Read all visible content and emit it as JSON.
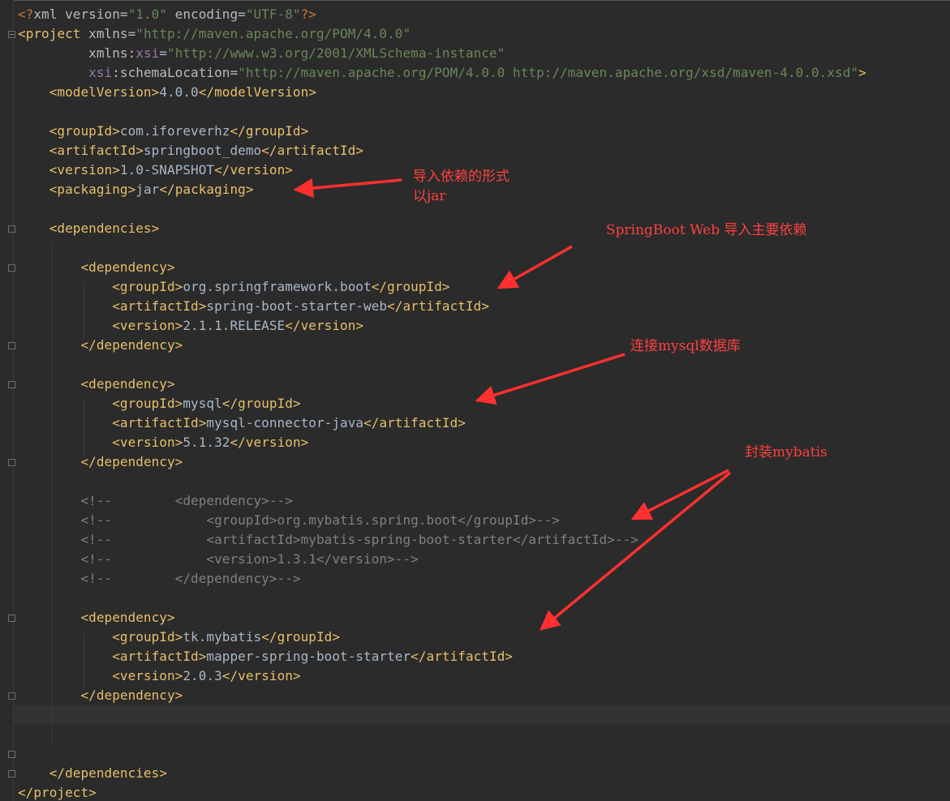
{
  "editor": {
    "colors": {
      "background": "#2b2b2b",
      "tag": "#e8bf6a",
      "string": "#6a8759",
      "namespace": "#9876aa",
      "text": "#a9b7c6",
      "comment": "#808080",
      "annotation": "#ff4040"
    },
    "lines": [
      {
        "indent": "",
        "tokens": [
          [
            "pi",
            "<?"
          ],
          [
            "attr",
            "xml version"
          ],
          [
            "text",
            "="
          ],
          [
            "str",
            "\"1.0\""
          ],
          [
            "attr",
            " encoding"
          ],
          [
            "text",
            "="
          ],
          [
            "str",
            "\"UTF-8\""
          ],
          [
            "pi",
            "?>"
          ]
        ]
      },
      {
        "indent": "",
        "tokens": [
          [
            "bracket",
            "<"
          ],
          [
            "tag",
            "project "
          ],
          [
            "attr",
            "xmlns"
          ],
          [
            "text",
            "="
          ],
          [
            "str",
            "\"http://maven.apache.org/POM/4.0.0\""
          ]
        ]
      },
      {
        "indent": "         ",
        "tokens": [
          [
            "attr",
            "xmlns:"
          ],
          [
            "ns",
            "xsi"
          ],
          [
            "text",
            "="
          ],
          [
            "str",
            "\"http://www.w3.org/2001/XMLSchema-instance\""
          ]
        ]
      },
      {
        "indent": "         ",
        "tokens": [
          [
            "ns",
            "xsi"
          ],
          [
            "attr",
            ":schemaLocation"
          ],
          [
            "text",
            "="
          ],
          [
            "str",
            "\"http://maven.apache.org/POM/4.0.0 http://maven.apache.org/xsd/maven-4.0.0.xsd\""
          ],
          [
            "bracket",
            ">"
          ]
        ]
      },
      {
        "indent": "    ",
        "tokens": [
          [
            "bracket",
            "<"
          ],
          [
            "tag",
            "modelVersion"
          ],
          [
            "bracket",
            ">"
          ],
          [
            "text",
            "4.0.0"
          ],
          [
            "bracket",
            "</"
          ],
          [
            "tag",
            "modelVersion"
          ],
          [
            "bracket",
            ">"
          ]
        ]
      },
      {
        "indent": "",
        "tokens": []
      },
      {
        "indent": "    ",
        "tokens": [
          [
            "bracket",
            "<"
          ],
          [
            "tag",
            "groupId"
          ],
          [
            "bracket",
            ">"
          ],
          [
            "text",
            "com.iforeverhz"
          ],
          [
            "bracket",
            "</"
          ],
          [
            "tag",
            "groupId"
          ],
          [
            "bracket",
            ">"
          ]
        ]
      },
      {
        "indent": "    ",
        "tokens": [
          [
            "bracket",
            "<"
          ],
          [
            "tag",
            "artifactId"
          ],
          [
            "bracket",
            ">"
          ],
          [
            "text",
            "springboot_demo"
          ],
          [
            "bracket",
            "</"
          ],
          [
            "tag",
            "artifactId"
          ],
          [
            "bracket",
            ">"
          ]
        ]
      },
      {
        "indent": "    ",
        "tokens": [
          [
            "bracket",
            "<"
          ],
          [
            "tag",
            "version"
          ],
          [
            "bracket",
            ">"
          ],
          [
            "text",
            "1.0-SNAPSHOT"
          ],
          [
            "bracket",
            "</"
          ],
          [
            "tag",
            "version"
          ],
          [
            "bracket",
            ">"
          ]
        ]
      },
      {
        "indent": "    ",
        "tokens": [
          [
            "bracket",
            "<"
          ],
          [
            "tag",
            "packaging"
          ],
          [
            "bracket",
            ">"
          ],
          [
            "text",
            "jar"
          ],
          [
            "bracket",
            "</"
          ],
          [
            "tag",
            "packaging"
          ],
          [
            "bracket",
            ">"
          ]
        ]
      },
      {
        "indent": "",
        "tokens": []
      },
      {
        "indent": "    ",
        "tokens": [
          [
            "bracket",
            "<"
          ],
          [
            "tag",
            "dependencies"
          ],
          [
            "bracket",
            ">"
          ]
        ]
      },
      {
        "indent": "",
        "tokens": []
      },
      {
        "indent": "        ",
        "tokens": [
          [
            "bracket",
            "<"
          ],
          [
            "tag",
            "dependency"
          ],
          [
            "bracket",
            ">"
          ]
        ]
      },
      {
        "indent": "            ",
        "tokens": [
          [
            "bracket",
            "<"
          ],
          [
            "tag",
            "groupId"
          ],
          [
            "bracket",
            ">"
          ],
          [
            "text",
            "org.springframework.boot"
          ],
          [
            "bracket",
            "</"
          ],
          [
            "tag",
            "groupId"
          ],
          [
            "bracket",
            ">"
          ]
        ]
      },
      {
        "indent": "            ",
        "tokens": [
          [
            "bracket",
            "<"
          ],
          [
            "tag",
            "artifactId"
          ],
          [
            "bracket",
            ">"
          ],
          [
            "text",
            "spring-boot-starter-web"
          ],
          [
            "bracket",
            "</"
          ],
          [
            "tag",
            "artifactId"
          ],
          [
            "bracket",
            ">"
          ]
        ]
      },
      {
        "indent": "            ",
        "tokens": [
          [
            "bracket",
            "<"
          ],
          [
            "tag",
            "version"
          ],
          [
            "bracket",
            ">"
          ],
          [
            "text",
            "2.1.1.RELEASE"
          ],
          [
            "bracket",
            "</"
          ],
          [
            "tag",
            "version"
          ],
          [
            "bracket",
            ">"
          ]
        ]
      },
      {
        "indent": "        ",
        "tokens": [
          [
            "bracket",
            "</"
          ],
          [
            "tag",
            "dependency"
          ],
          [
            "bracket",
            ">"
          ]
        ]
      },
      {
        "indent": "",
        "tokens": []
      },
      {
        "indent": "        ",
        "tokens": [
          [
            "bracket",
            "<"
          ],
          [
            "tag",
            "dependency"
          ],
          [
            "bracket",
            ">"
          ]
        ]
      },
      {
        "indent": "            ",
        "tokens": [
          [
            "bracket",
            "<"
          ],
          [
            "tag",
            "groupId"
          ],
          [
            "bracket",
            ">"
          ],
          [
            "text",
            "mysql"
          ],
          [
            "bracket",
            "</"
          ],
          [
            "tag",
            "groupId"
          ],
          [
            "bracket",
            ">"
          ]
        ]
      },
      {
        "indent": "            ",
        "tokens": [
          [
            "bracket",
            "<"
          ],
          [
            "tag",
            "artifactId"
          ],
          [
            "bracket",
            ">"
          ],
          [
            "text",
            "mysql-connector-java"
          ],
          [
            "bracket",
            "</"
          ],
          [
            "tag",
            "artifactId"
          ],
          [
            "bracket",
            ">"
          ]
        ]
      },
      {
        "indent": "            ",
        "tokens": [
          [
            "bracket",
            "<"
          ],
          [
            "tag",
            "version"
          ],
          [
            "bracket",
            ">"
          ],
          [
            "text",
            "5.1.32"
          ],
          [
            "bracket",
            "</"
          ],
          [
            "tag",
            "version"
          ],
          [
            "bracket",
            ">"
          ]
        ]
      },
      {
        "indent": "        ",
        "tokens": [
          [
            "bracket",
            "</"
          ],
          [
            "tag",
            "dependency"
          ],
          [
            "bracket",
            ">"
          ]
        ]
      },
      {
        "indent": "",
        "tokens": []
      },
      {
        "indent": "        ",
        "tokens": [
          [
            "comment",
            "<!--        <dependency>-->"
          ]
        ]
      },
      {
        "indent": "        ",
        "tokens": [
          [
            "comment",
            "<!--            <groupId>org.mybatis.spring.boot</groupId>-->"
          ]
        ]
      },
      {
        "indent": "        ",
        "tokens": [
          [
            "comment",
            "<!--            <artifactId>mybatis-spring-boot-starter</artifactId>-->"
          ]
        ]
      },
      {
        "indent": "        ",
        "tokens": [
          [
            "comment",
            "<!--            <version>1.3.1</version>-->"
          ]
        ]
      },
      {
        "indent": "        ",
        "tokens": [
          [
            "comment",
            "<!--        </dependency>-->"
          ]
        ]
      },
      {
        "indent": "",
        "tokens": []
      },
      {
        "indent": "        ",
        "tokens": [
          [
            "bracket",
            "<"
          ],
          [
            "tag",
            "dependency"
          ],
          [
            "bracket",
            ">"
          ]
        ]
      },
      {
        "indent": "            ",
        "tokens": [
          [
            "bracket",
            "<"
          ],
          [
            "tag",
            "groupId"
          ],
          [
            "bracket",
            ">"
          ],
          [
            "text",
            "tk.mybatis"
          ],
          [
            "bracket",
            "</"
          ],
          [
            "tag",
            "groupId"
          ],
          [
            "bracket",
            ">"
          ]
        ]
      },
      {
        "indent": "            ",
        "tokens": [
          [
            "bracket",
            "<"
          ],
          [
            "tag",
            "artifactId"
          ],
          [
            "bracket",
            ">"
          ],
          [
            "text",
            "mapper-spring-boot-starter"
          ],
          [
            "bracket",
            "</"
          ],
          [
            "tag",
            "artifactId"
          ],
          [
            "bracket",
            ">"
          ]
        ]
      },
      {
        "indent": "            ",
        "tokens": [
          [
            "bracket",
            "<"
          ],
          [
            "tag",
            "version"
          ],
          [
            "bracket",
            ">"
          ],
          [
            "text",
            "2.0.3"
          ],
          [
            "bracket",
            "</"
          ],
          [
            "tag",
            "version"
          ],
          [
            "bracket",
            ">"
          ]
        ]
      },
      {
        "indent": "        ",
        "tokens": [
          [
            "bracket",
            "</"
          ],
          [
            "tag",
            "dependency"
          ],
          [
            "bracket",
            ">"
          ]
        ]
      },
      {
        "indent": "",
        "tokens": []
      },
      {
        "indent": "",
        "tokens": []
      },
      {
        "indent": "",
        "tokens": []
      },
      {
        "indent": "    ",
        "tokens": [
          [
            "bracket",
            "</"
          ],
          [
            "tag",
            "dependencies"
          ],
          [
            "bracket",
            ">"
          ]
        ]
      },
      {
        "indent": "",
        "tokens": [
          [
            "bracket",
            "</"
          ],
          [
            "tag",
            "project"
          ],
          [
            "bracket",
            ">"
          ]
        ]
      }
    ]
  },
  "annotations": {
    "packaging_line1": "导入依赖的形式",
    "packaging_line2": "以jar",
    "springboot_web": "SpringBoot Web 导入主要依赖",
    "mysql": "连接mysql数据库",
    "mybatis": "封装mybatis"
  }
}
